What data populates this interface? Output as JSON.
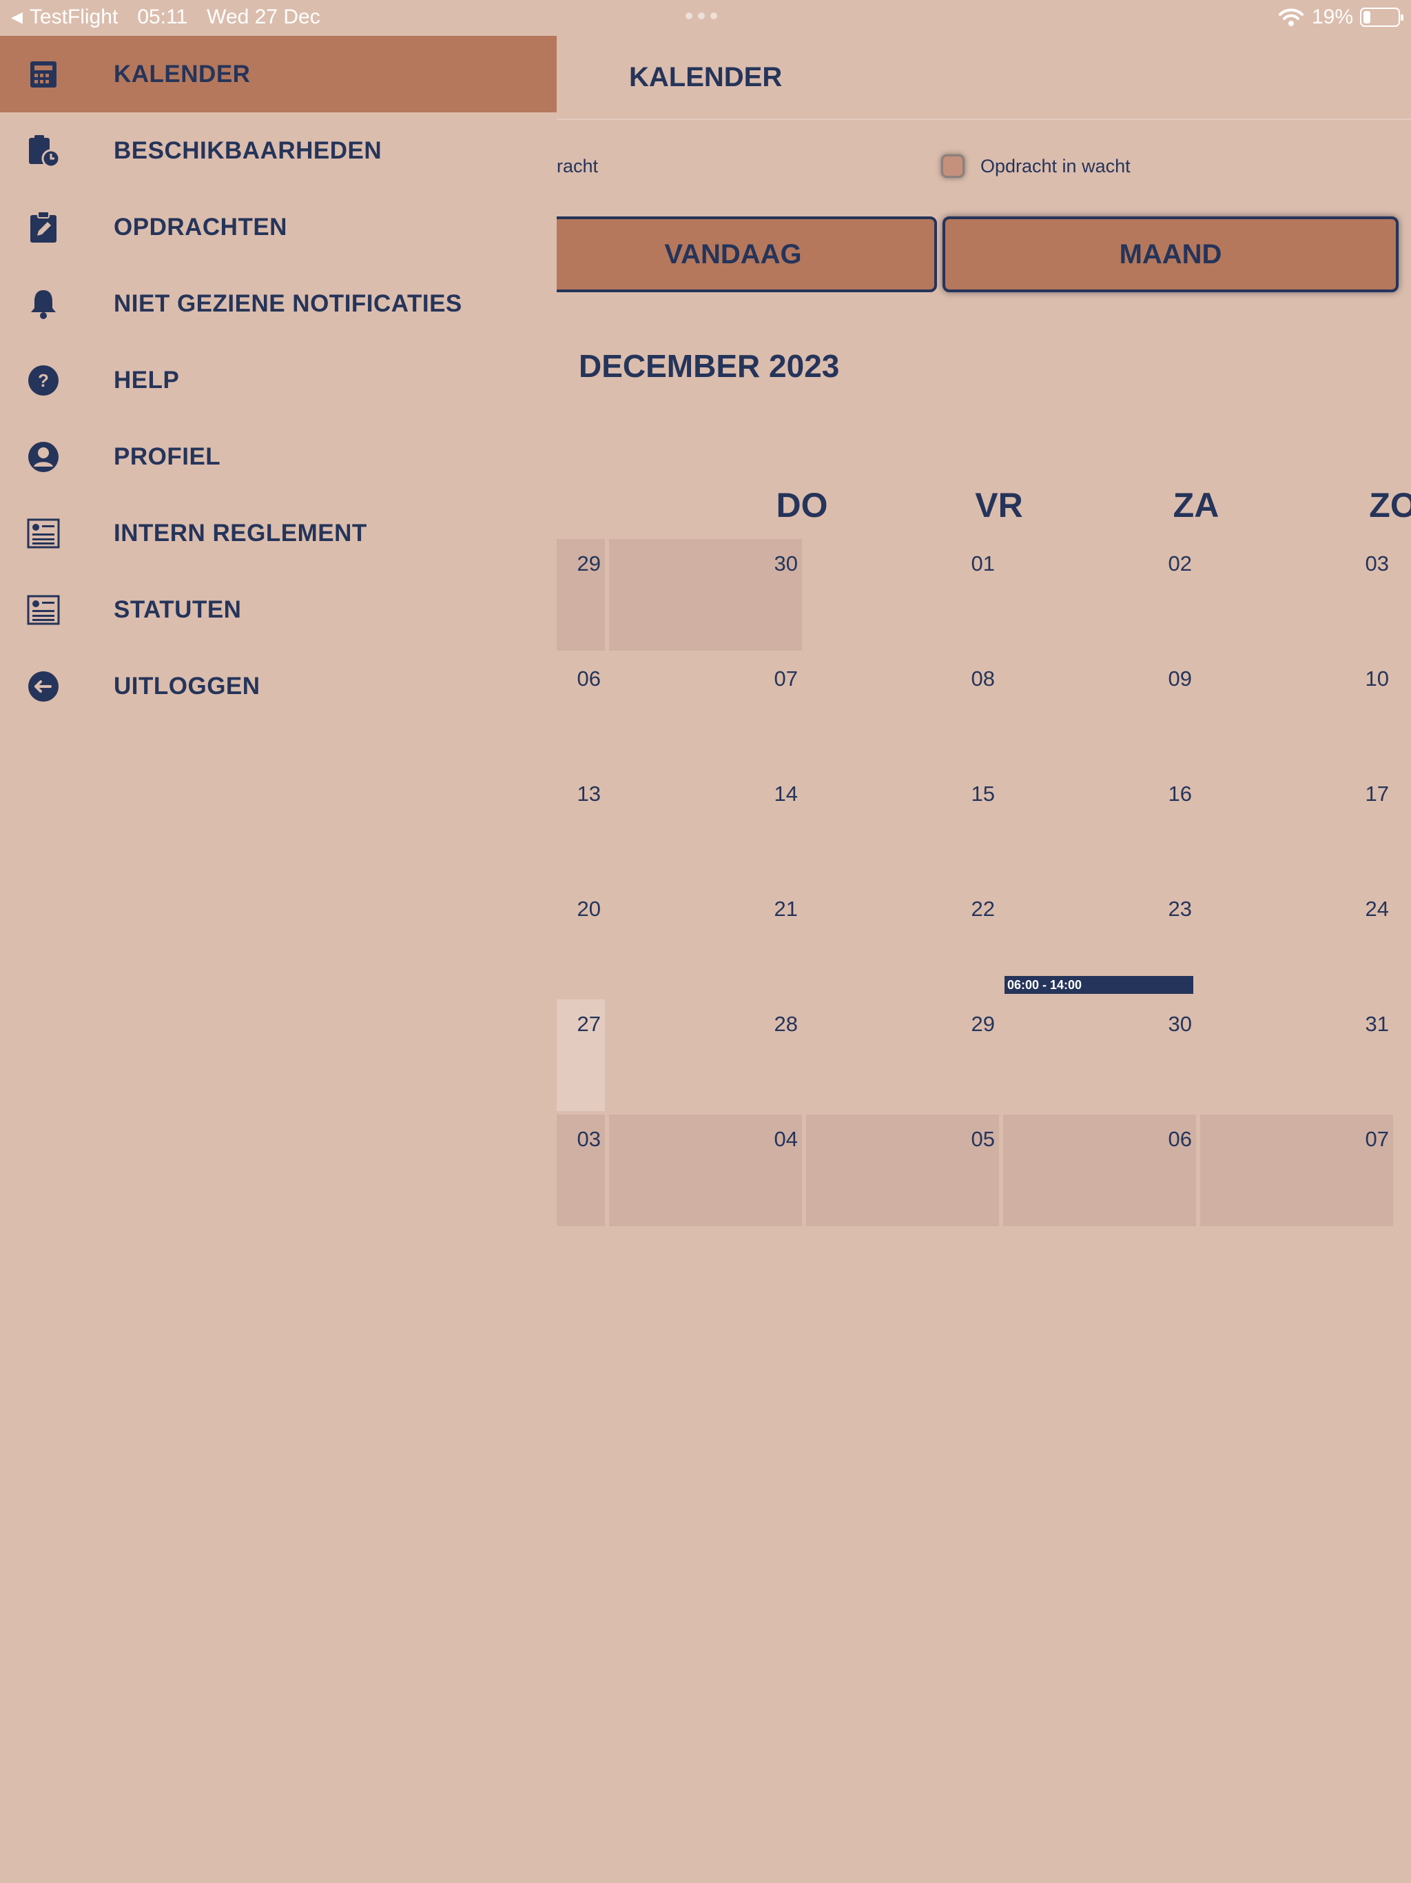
{
  "status_bar": {
    "back_app": "TestFlight",
    "time": "05:11",
    "date": "Wed 27 Dec",
    "battery": "19%",
    "battery_level": 0.19
  },
  "sidebar": {
    "items": [
      {
        "label": "KALENDER",
        "icon": "calendar-icon",
        "active": true
      },
      {
        "label": "BESCHIKBAARHEDEN",
        "icon": "clipboard-clock-icon"
      },
      {
        "label": "OPDRACHTEN",
        "icon": "clipboard-pen-icon"
      },
      {
        "label": "NIET GEZIENE NOTIFICATIES",
        "icon": "bell-icon"
      },
      {
        "label": "HELP",
        "icon": "question-circle-icon"
      },
      {
        "label": "PROFIEL",
        "icon": "user-circle-icon"
      },
      {
        "label": "INTERN REGLEMENT",
        "icon": "document-list-icon"
      },
      {
        "label": "STATUTEN",
        "icon": "document-list-icon"
      },
      {
        "label": "UITLOGGEN",
        "icon": "logout-arrow-icon"
      }
    ]
  },
  "main": {
    "title": "KALENDER",
    "legend_left": "racht",
    "legend_right": "Opdracht in wacht",
    "today_button": "VANDAAG",
    "month_button": "MAAND",
    "month_title": "DECEMBER 2023",
    "weekdays": [
      "DO",
      "VR",
      "ZA",
      "ZO"
    ],
    "weeks": [
      [
        "29",
        "30",
        "01",
        "02",
        "03"
      ],
      [
        "06",
        "07",
        "08",
        "09",
        "10"
      ],
      [
        "13",
        "14",
        "15",
        "16",
        "17"
      ],
      [
        "20",
        "21",
        "22",
        "23",
        "24"
      ],
      [
        "27",
        "28",
        "29",
        "30",
        "31"
      ],
      [
        "03",
        "04",
        "05",
        "06",
        "07"
      ]
    ],
    "event": "06:00 - 14:00"
  }
}
